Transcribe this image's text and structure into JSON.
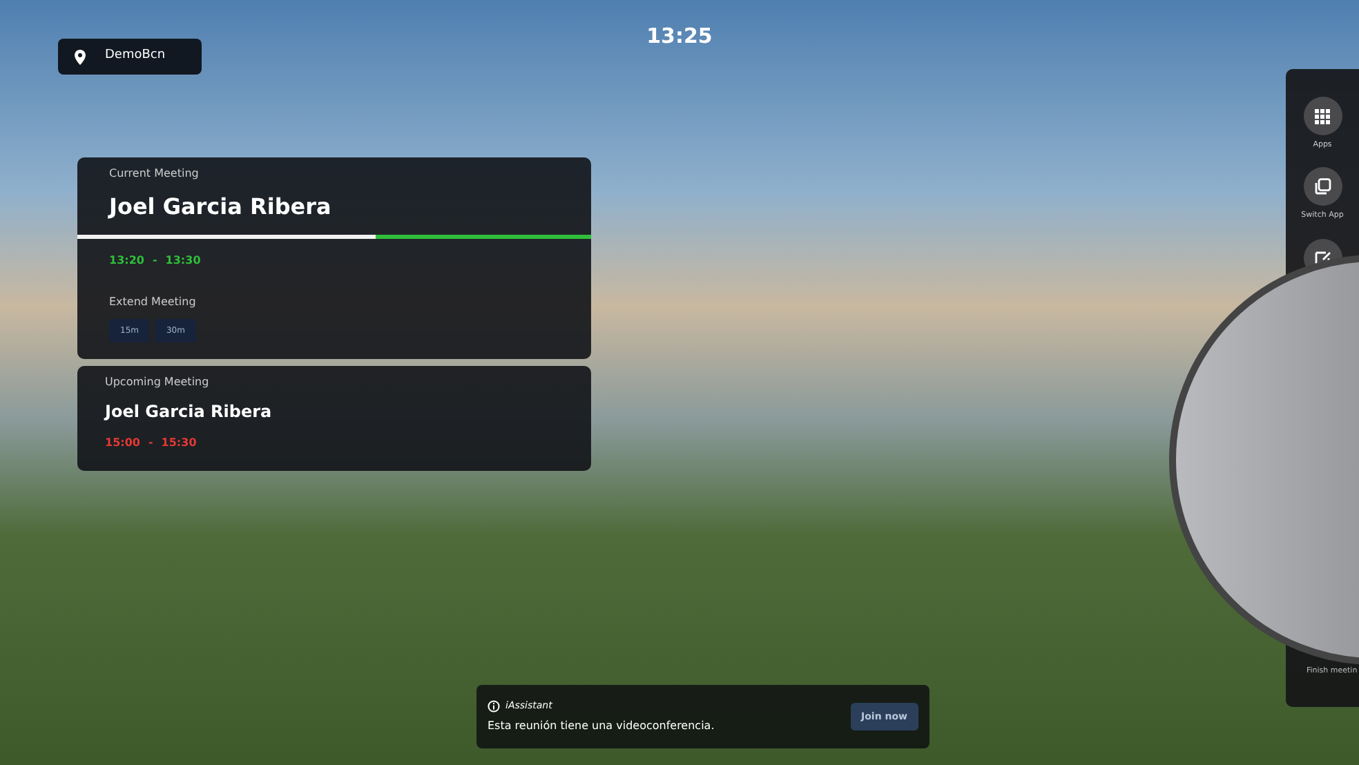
{
  "location": {
    "label": "DemoBcn"
  },
  "clock": "13:25",
  "meetings": [
    {
      "kind": "current",
      "heading": "Current Meeting",
      "title": "Joel Garcia Ribera",
      "level": 0.58,
      "time_start": "13:20",
      "time_sep": "-",
      "time_end": "13:30",
      "color": "#2fbf3a",
      "extend_label": "Extend Meeting",
      "extend_options": [
        "15m",
        "30m"
      ]
    },
    {
      "kind": "upcoming",
      "heading": "Upcoming Meeting",
      "title": "Joel Garcia Ribera",
      "time_start": "15:00",
      "time_sep": "-",
      "time_end": "15:30",
      "color": "#e53935"
    }
  ],
  "sidebar": {
    "items": [
      {
        "kind": "grid",
        "label": "Apps"
      },
      {
        "kind": "copy",
        "label": "Switch App"
      },
      {
        "kind": "edit"
      }
    ],
    "footer": "Finish meetin"
  },
  "notification": {
    "source": "iAssistant",
    "message": "Esta reunión tiene una videoconferencia.",
    "action": "Join now"
  }
}
